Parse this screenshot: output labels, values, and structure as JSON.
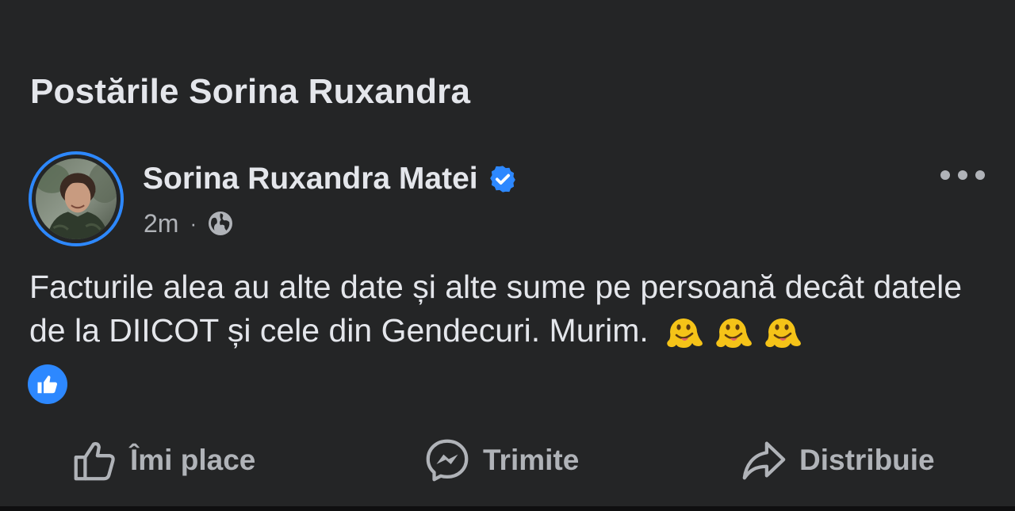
{
  "section": {
    "title": "Postările Sorina Ruxandra"
  },
  "post": {
    "author": "Sorina Ruxandra Matei",
    "verified": true,
    "time": "2m",
    "separator": "·",
    "audience_icon": "globe-icon",
    "text": "Facturile alea au alte date și alte sume pe persoană decât datele de la DIICOT și cele din Gendecuri. Murim.",
    "emojis": [
      "melting-face-emoji",
      "melting-face-emoji",
      "melting-face-emoji"
    ],
    "reaction_icon": "like-reaction-icon"
  },
  "actions": {
    "like_label": "Îmi place",
    "send_label": "Trimite",
    "share_label": "Distribuie"
  },
  "colors": {
    "background": "#242526",
    "primary_text": "#e4e6eb",
    "secondary_text": "#b0b3b8",
    "accent": "#2d88ff",
    "emoji": "#f5c318"
  }
}
